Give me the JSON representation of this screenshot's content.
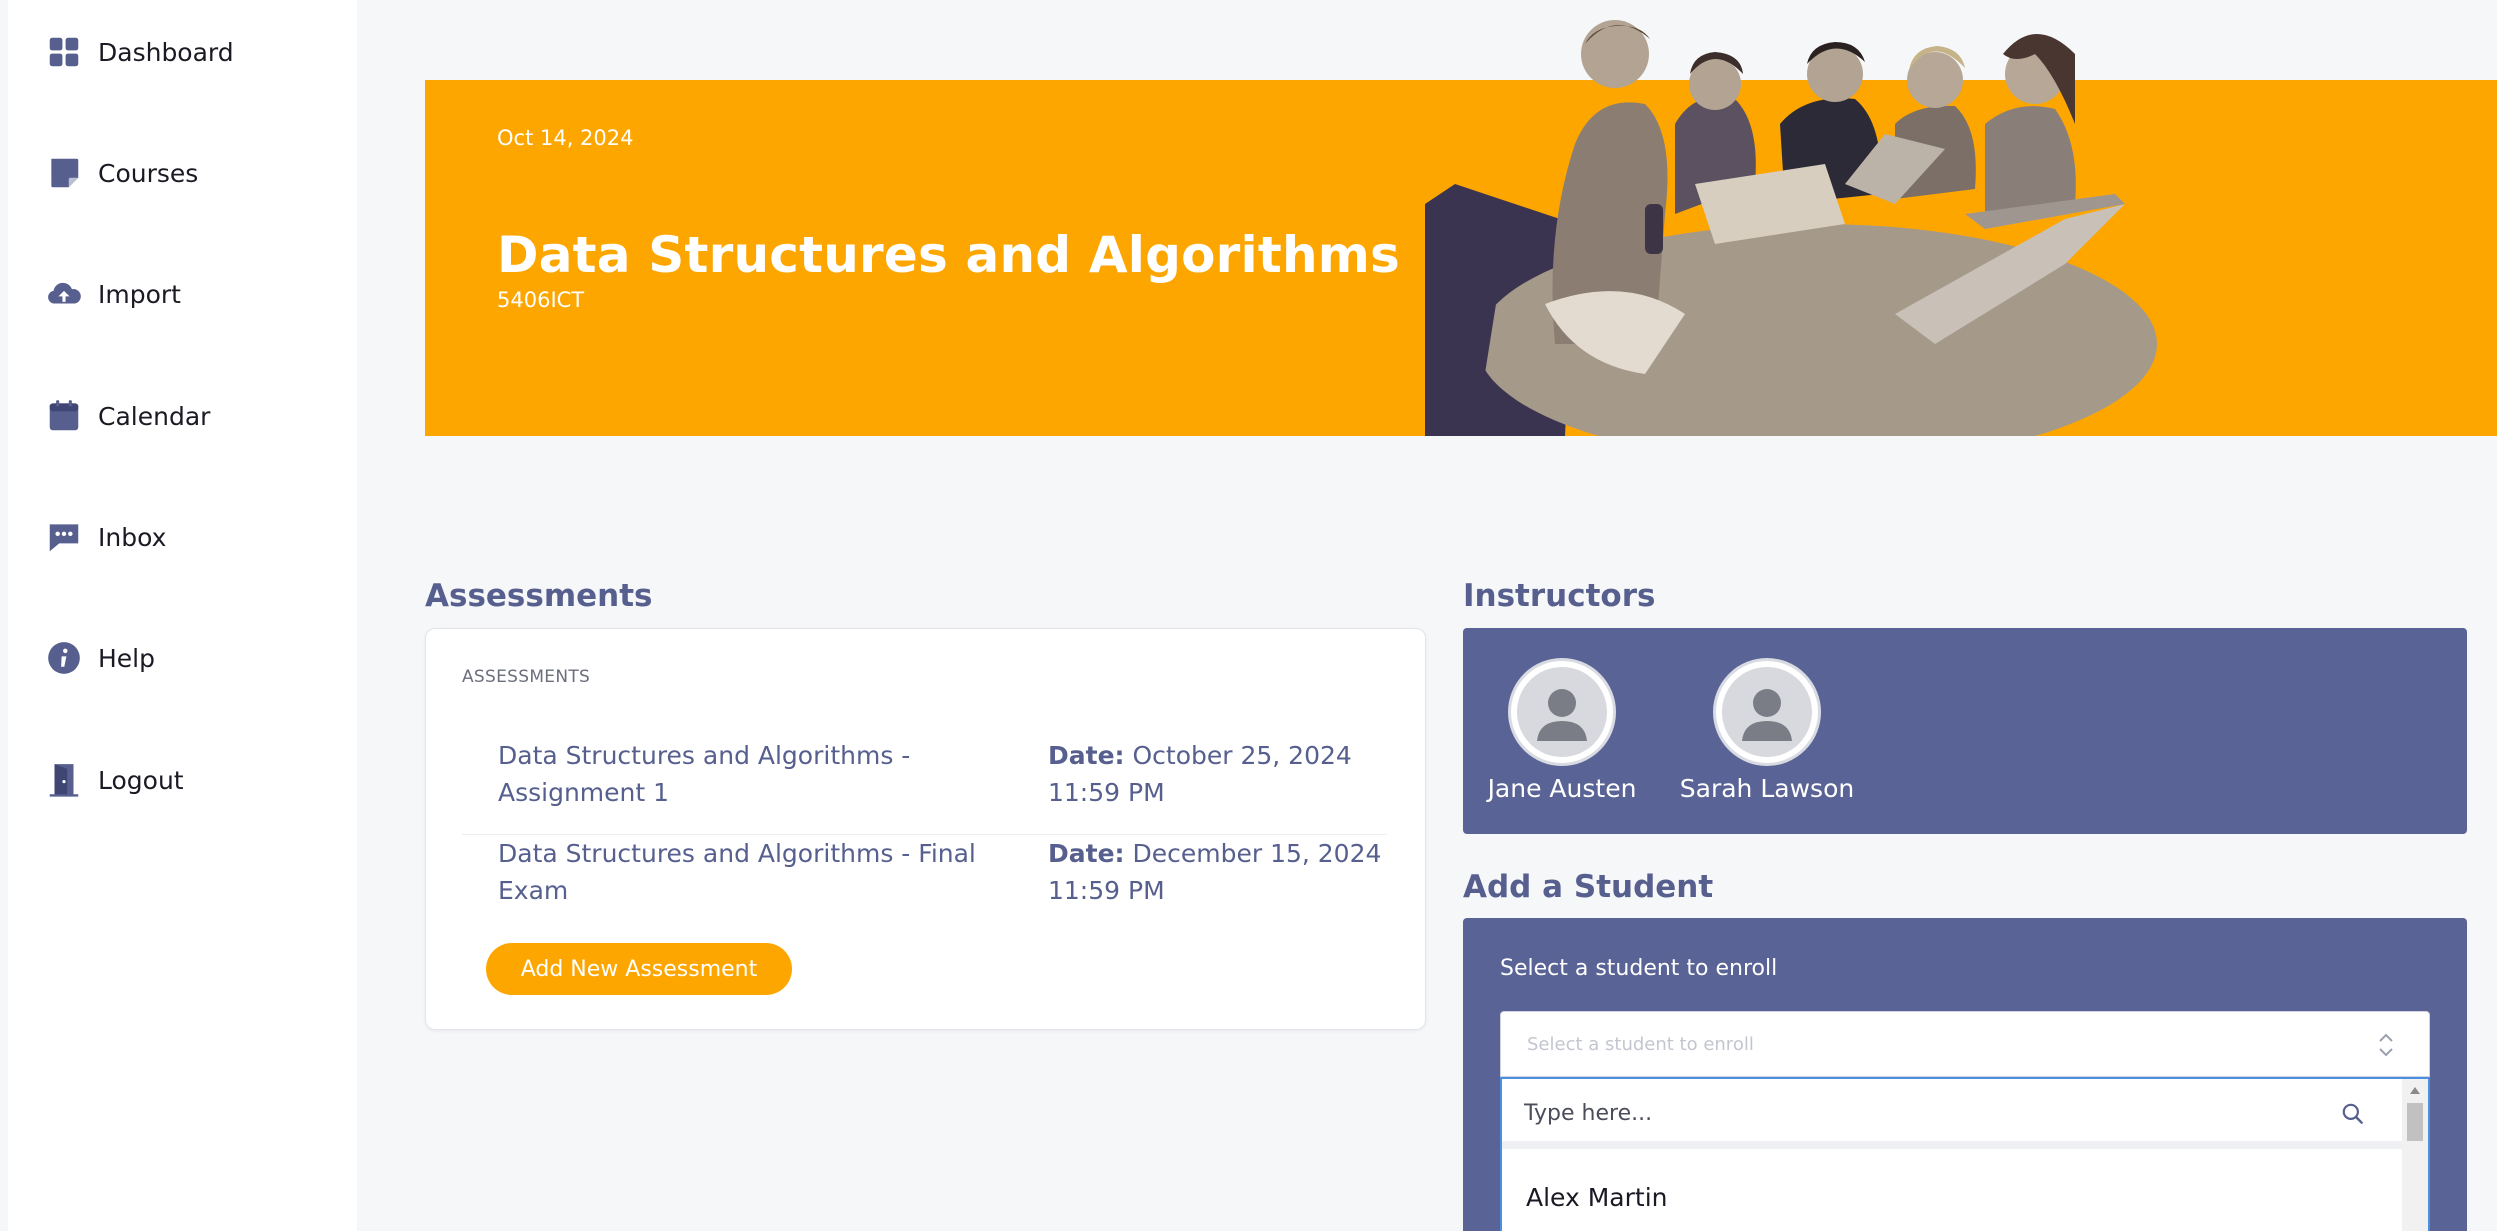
{
  "sidebar": {
    "items": [
      {
        "label": "Dashboard",
        "icon": "grid-icon"
      },
      {
        "label": "Courses",
        "icon": "note-icon"
      },
      {
        "label": "Import",
        "icon": "cloud-upload-icon"
      },
      {
        "label": "Calendar",
        "icon": "calendar-icon"
      },
      {
        "label": "Inbox",
        "icon": "chat-icon"
      },
      {
        "label": "Help",
        "icon": "info-icon"
      },
      {
        "label": "Logout",
        "icon": "door-icon"
      }
    ]
  },
  "banner": {
    "date": "Oct 14, 2024",
    "title": "Data Structures and Algorithms",
    "code": "5406ICT",
    "image": "students-group-photo"
  },
  "assessments": {
    "heading": "Assessments",
    "caption": "ASSESSMENTS",
    "date_label": "Date:",
    "items": [
      {
        "name": "Data Structures and Algorithms - Assignment 1",
        "date": "October 25, 2024 11:59 PM"
      },
      {
        "name": "Data Structures and Algorithms - Final Exam",
        "date": "December 15, 2024 11:59 PM"
      }
    ],
    "add_button": "Add New Assessment"
  },
  "instructors": {
    "heading": "Instructors",
    "people": [
      {
        "name": "Jane Austen"
      },
      {
        "name": "Sarah Lawson"
      }
    ]
  },
  "add_student": {
    "heading": "Add a Student",
    "label": "Select a student to enroll",
    "select_placeholder": "Select a student to enroll",
    "search_placeholder": "Type here...",
    "options": [
      "Alex Martin"
    ]
  },
  "colors": {
    "accent": "#fea600",
    "primary": "#5a6395",
    "background": "#f6f7f9"
  }
}
